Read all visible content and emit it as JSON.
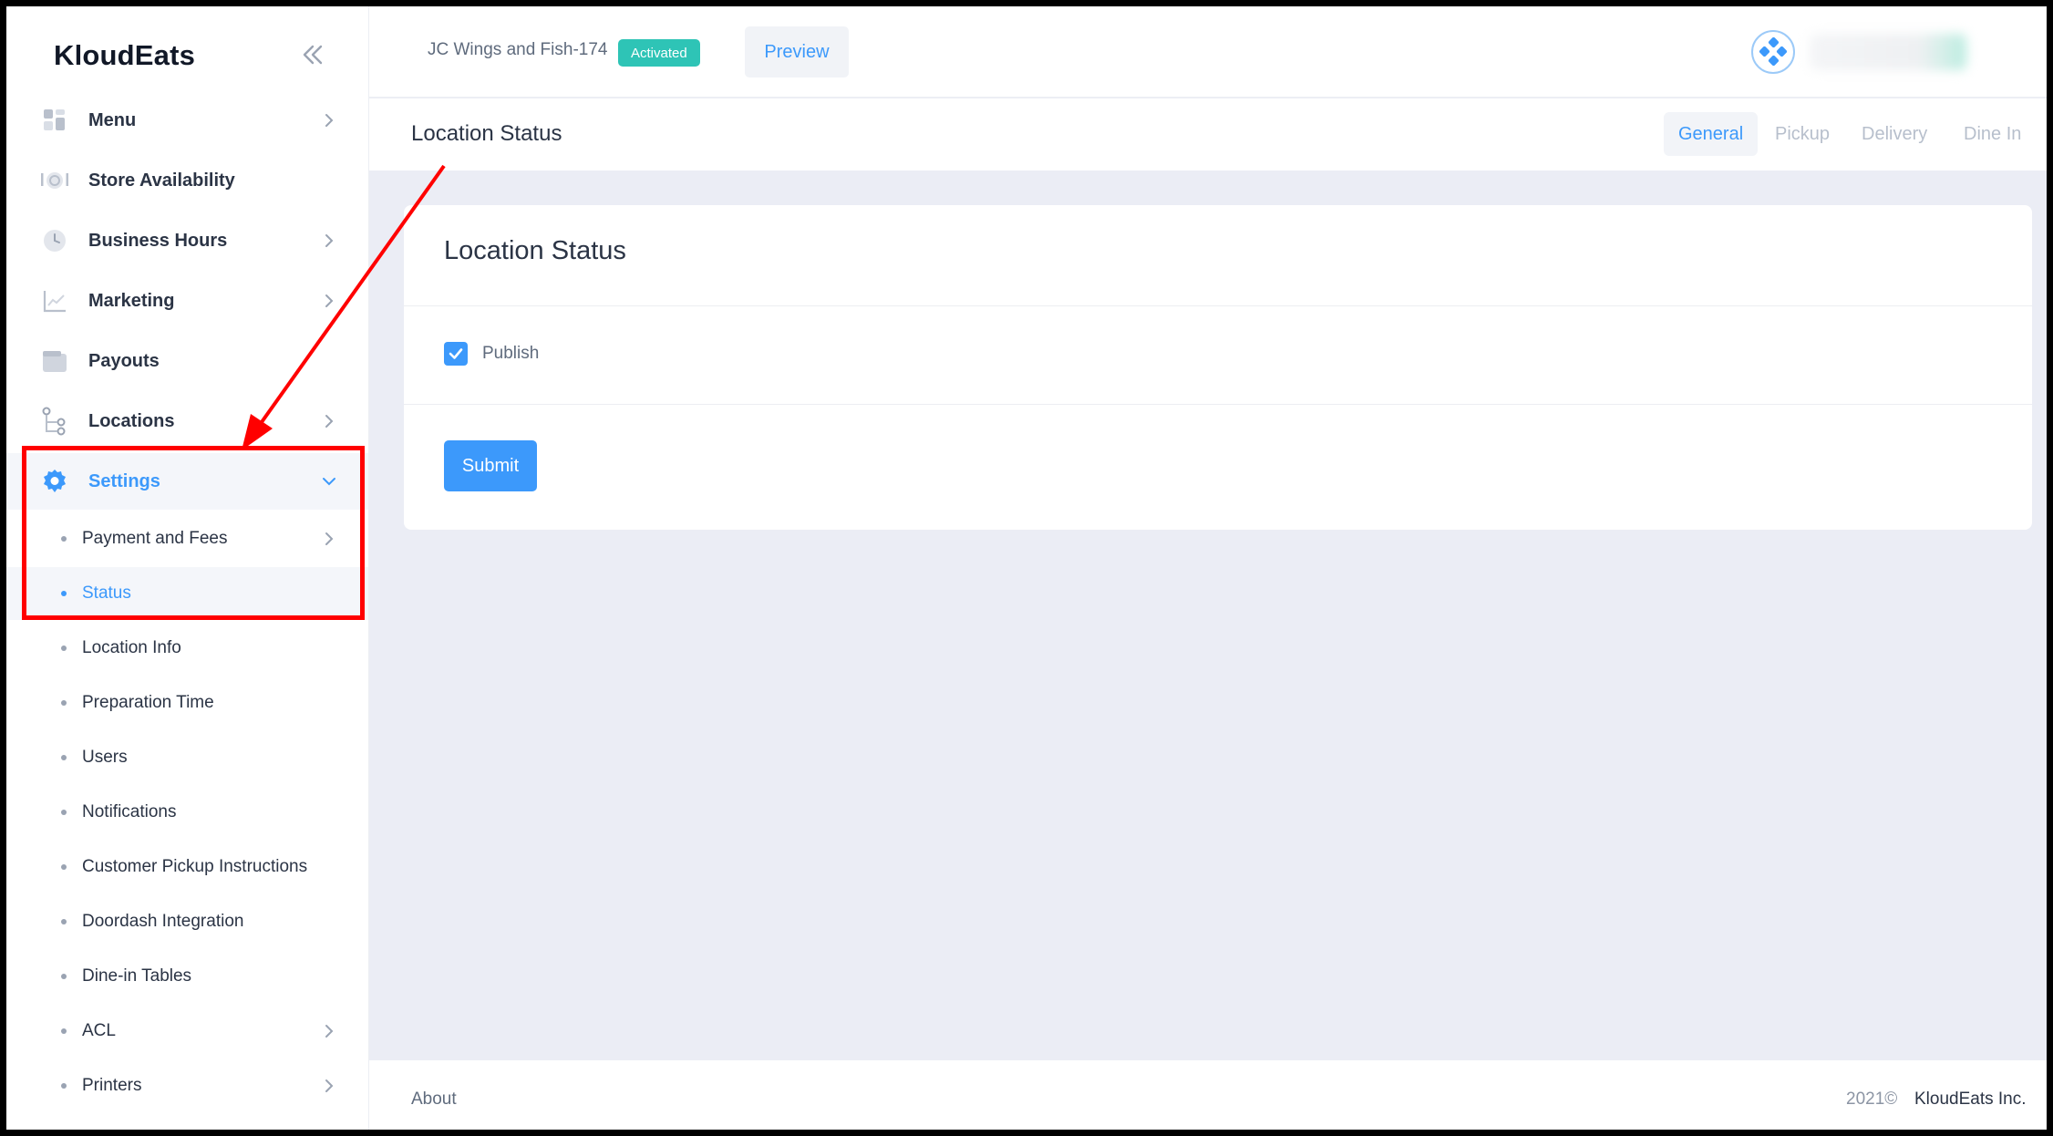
{
  "sidebar": {
    "brand": "KloudEats",
    "items": [
      {
        "label": "Menu",
        "icon": "menu-grid-icon",
        "chevron": true
      },
      {
        "label": "Store Availability",
        "icon": "plate-icon",
        "chevron": false
      },
      {
        "label": "Business Hours",
        "icon": "clock-icon",
        "chevron": true
      },
      {
        "label": "Marketing",
        "icon": "chart-icon",
        "chevron": true
      },
      {
        "label": "Payouts",
        "icon": "wallet-icon",
        "chevron": false
      },
      {
        "label": "Locations",
        "icon": "branch-icon",
        "chevron": true
      },
      {
        "label": "Settings",
        "icon": "gear-icon",
        "chevron": true,
        "expanded": true,
        "active": true
      }
    ],
    "sub_items": [
      {
        "label": "Payment and Fees",
        "chevron": true
      },
      {
        "label": "Status",
        "chevron": false,
        "active": true
      },
      {
        "label": "Location Info",
        "chevron": false
      },
      {
        "label": "Preparation Time",
        "chevron": false
      },
      {
        "label": "Users",
        "chevron": false
      },
      {
        "label": "Notifications",
        "chevron": false
      },
      {
        "label": "Customer Pickup Instructions",
        "chevron": false
      },
      {
        "label": "Doordash Integration",
        "chevron": false
      },
      {
        "label": "Dine-in Tables",
        "chevron": false
      },
      {
        "label": "ACL",
        "chevron": true
      },
      {
        "label": "Printers",
        "chevron": true
      }
    ]
  },
  "header": {
    "store_name": "JC Wings and Fish-174",
    "status_badge": "Activated",
    "preview_label": "Preview"
  },
  "subheader": {
    "title": "Location Status",
    "tabs": [
      "General",
      "Pickup",
      "Delivery",
      "Dine In"
    ],
    "active_tab": "General"
  },
  "card": {
    "title": "Location Status",
    "checkbox_label": "Publish",
    "checkbox_checked": true,
    "submit_label": "Submit"
  },
  "footer": {
    "about": "About",
    "year": "2021©",
    "company": "KloudEats Inc."
  },
  "colors": {
    "accent": "#3c99fb",
    "badge": "#2ec4b6",
    "annotation": "#ff0000",
    "background": "#ebedf5"
  }
}
